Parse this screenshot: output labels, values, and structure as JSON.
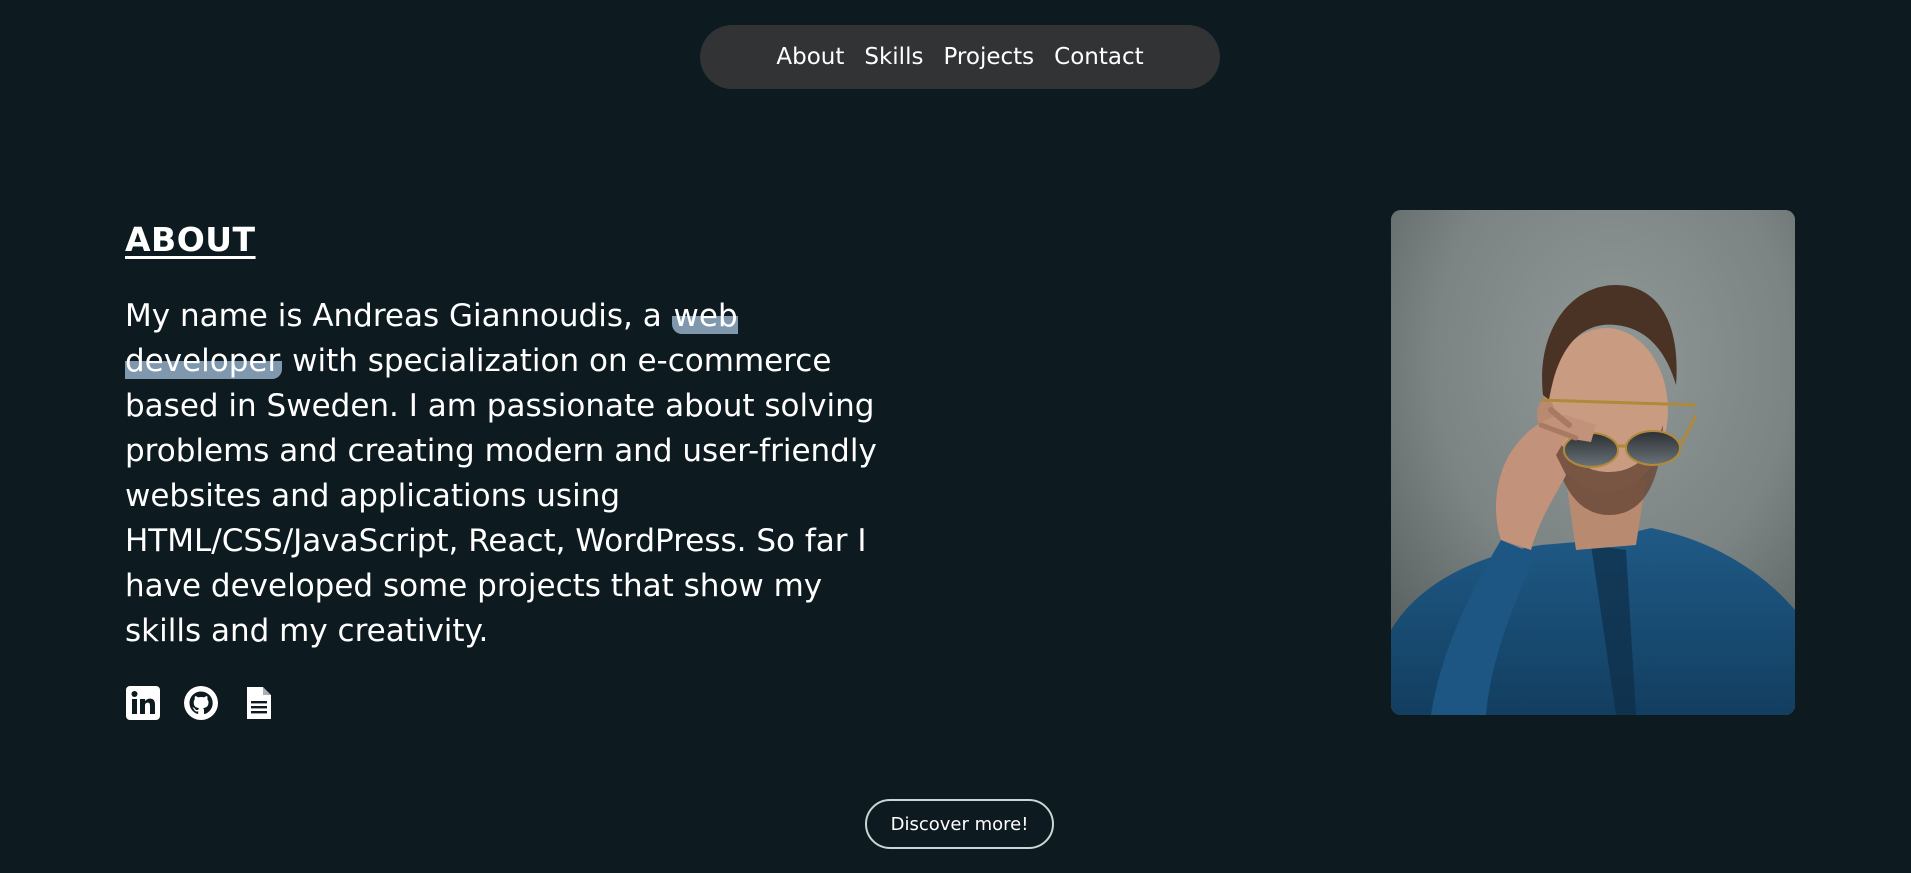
{
  "nav": {
    "items": [
      {
        "label": "About"
      },
      {
        "label": "Skills"
      },
      {
        "label": "Projects"
      },
      {
        "label": "Contact"
      }
    ]
  },
  "about": {
    "heading": "ABOUT",
    "bio_prefix": "My name is Andreas Giannoudis, a ",
    "bio_highlight": "web developer",
    "bio_suffix": " with specialization on e-commerce based in Sweden. I am passionate about solving problems and creating modern and user-friendly websites and applications using HTML/CSS/JavaScript, React, WordPress. So far I have developed some projects that show my skills and my creativity."
  },
  "socials": [
    {
      "icon": "linkedin-icon"
    },
    {
      "icon": "github-icon"
    },
    {
      "icon": "document-icon"
    }
  ],
  "discover_button": {
    "label": "Discover more!"
  },
  "colors": {
    "background": "#0d1a1f",
    "nav_background": "#313334",
    "highlight": "#7f98ad",
    "button_border": "#c9d6d3"
  }
}
